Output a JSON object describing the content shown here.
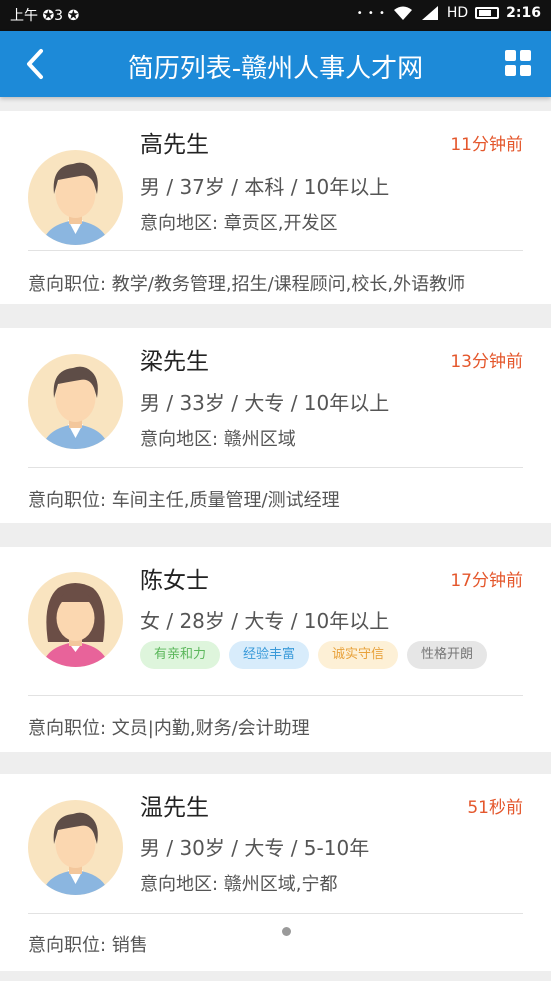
{
  "status_bar": {
    "left_text": "上午 ✪3 ✪",
    "hd": "HD",
    "time": "2:16"
  },
  "app_bar": {
    "title": "简历列表-赣州人事人才网"
  },
  "icons": {
    "back": "chevron-left-icon",
    "grid": "grid-menu-icon"
  },
  "colors": {
    "app_bar": "#1d8ad8",
    "time_red": "#e4572c",
    "tag_green": "#5bb75b",
    "tag_blue": "#3a9ad9",
    "tag_orange": "#e8a23c",
    "tag_gray": "#777777"
  },
  "resumes": [
    {
      "name": "高先生",
      "time": "11分钟前",
      "info": "男 / 37岁 / 本科 / 10年以上",
      "area": "意向地区: 章贡区,开发区",
      "job": "意向职位: 教学/教务管理,招生/课程顾问,校长,外语教师",
      "gender": "male"
    },
    {
      "name": "梁先生",
      "time": "13分钟前",
      "info": "男 / 33岁 / 大专 / 10年以上",
      "area": "意向地区: 赣州区域",
      "job": "意向职位: 车间主任,质量管理/测试经理",
      "gender": "male"
    },
    {
      "name": "陈女士",
      "time": "17分钟前",
      "info": "女 / 28岁 / 大专 / 10年以上",
      "tags": [
        "有亲和力",
        "经验丰富",
        "诚实守信",
        "性格开朗"
      ],
      "job": "意向职位: 文员|内勤,财务/会计助理",
      "gender": "female"
    },
    {
      "name": "温先生",
      "time": "51秒前",
      "info": "男 / 30岁 / 大专 / 5-10年",
      "area": "意向地区: 赣州区域,宁都",
      "job": "意向职位: 销售",
      "gender": "male"
    }
  ]
}
